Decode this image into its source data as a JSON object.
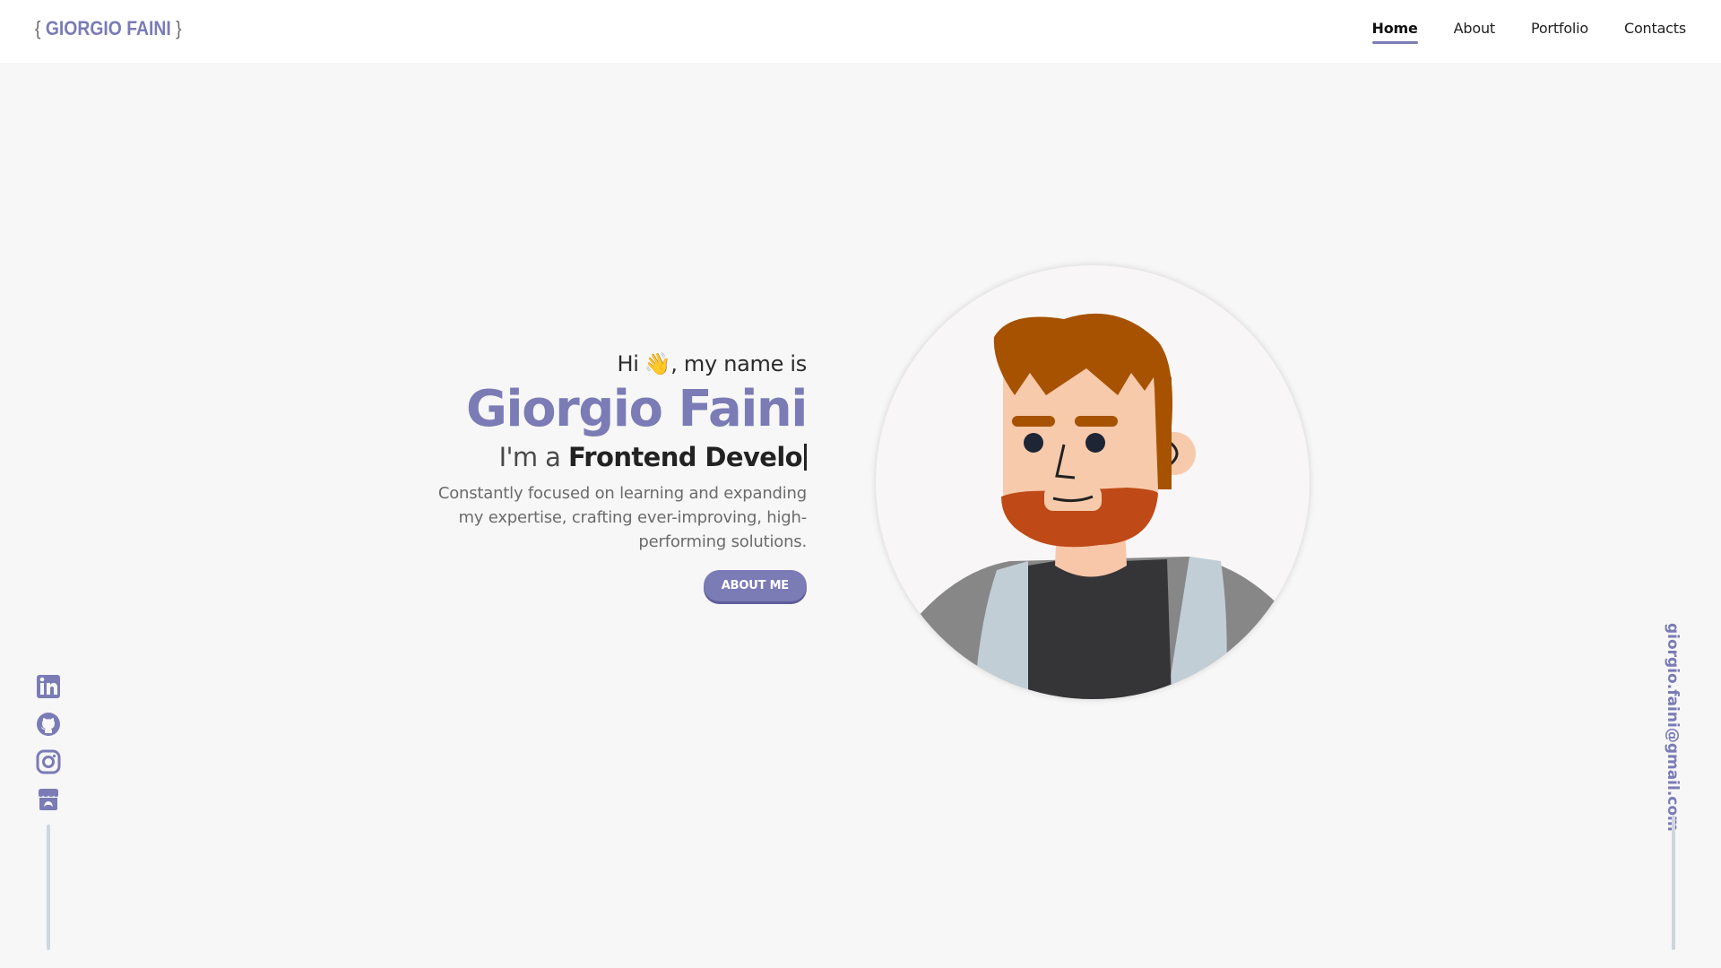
{
  "header": {
    "logo_open": "{",
    "logo_text": "GIORGIO FAINI",
    "logo_close": "}",
    "nav": [
      {
        "label": "Home",
        "active": true
      },
      {
        "label": "About",
        "active": false
      },
      {
        "label": "Portfolio",
        "active": false
      },
      {
        "label": "Contacts",
        "active": false
      }
    ]
  },
  "hero": {
    "greeting_before": "Hi",
    "greeting_emoji": "👋",
    "greeting_after": ", my name is",
    "name": "Giorgio Faini",
    "role_prefix": "I'm a",
    "role_typed": "Frontend Develo",
    "description": "Constantly focused on learning and expanding my expertise, crafting ever-improving, high-performing solutions.",
    "button_label": "ABOUT ME"
  },
  "socials": [
    {
      "name": "linkedin-icon"
    },
    {
      "name": "github-icon"
    },
    {
      "name": "instagram-icon"
    },
    {
      "name": "itchio-icon"
    }
  ],
  "email": "giorgio.faini@gmail.com",
  "colors": {
    "accent": "#7b7bb6",
    "background": "#f7f7f7",
    "header": "#ffffff",
    "line": "#cfd6dd"
  }
}
